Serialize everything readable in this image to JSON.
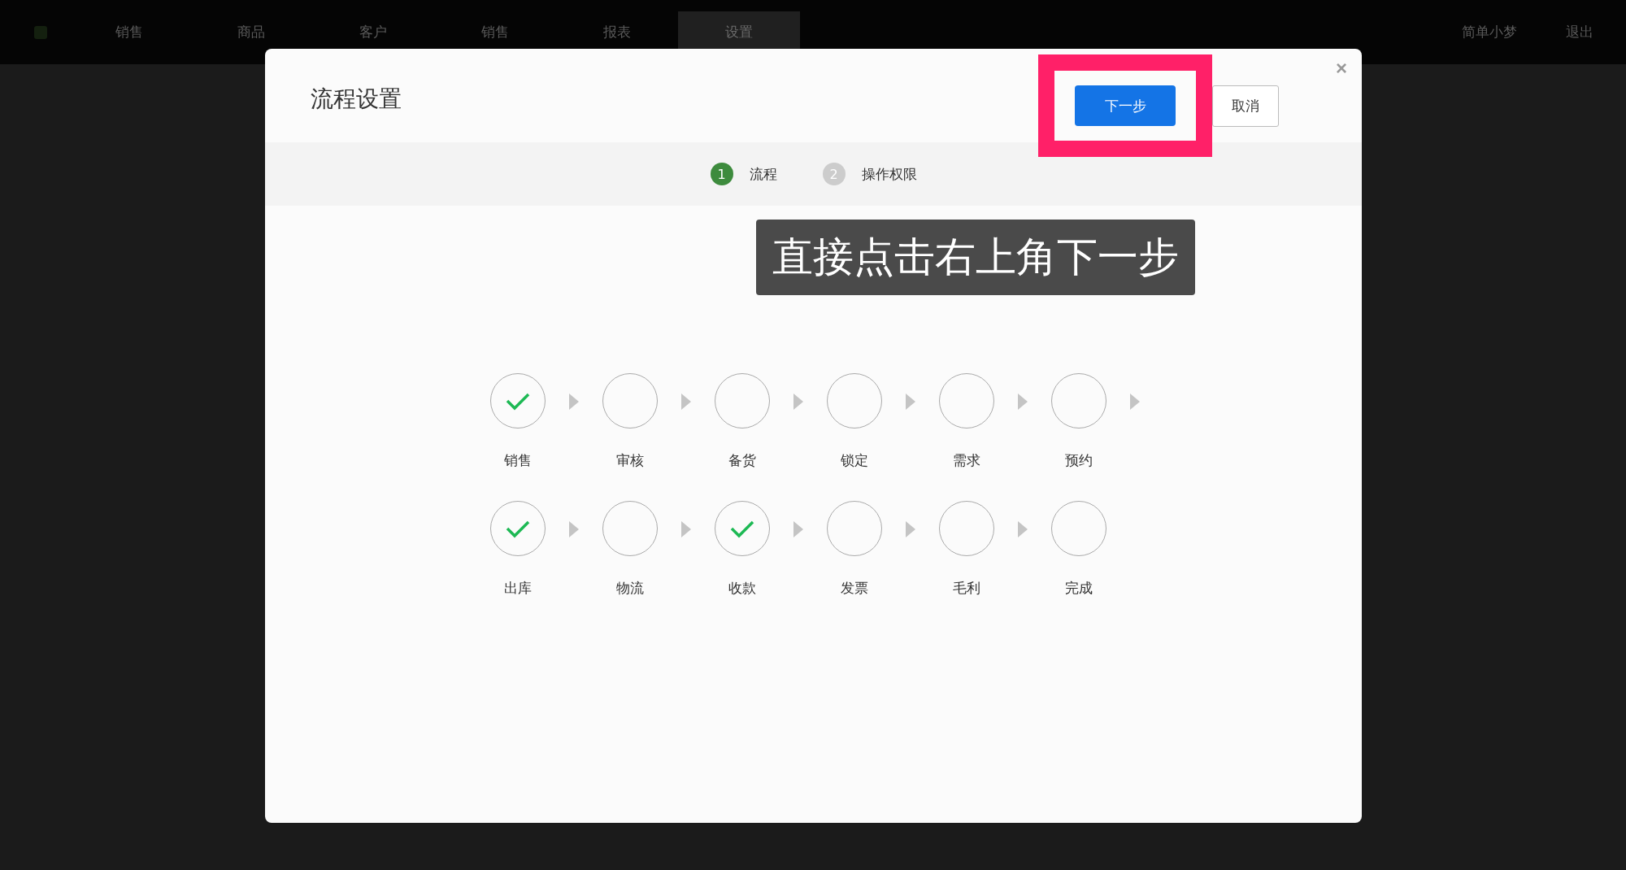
{
  "top_bar": {
    "nav": [
      {
        "label": "销售",
        "selected": false
      },
      {
        "label": "商品",
        "selected": false
      },
      {
        "label": "客户",
        "selected": false
      },
      {
        "label": "销售",
        "selected": false
      },
      {
        "label": "报表",
        "selected": false
      },
      {
        "label": "设置",
        "selected": true
      }
    ],
    "user": "简单小梦",
    "logout": "退出"
  },
  "dialog": {
    "title": "流程设置",
    "next_button": "下一步",
    "cancel_button": "取消",
    "close": "×",
    "steps": [
      {
        "number": "1",
        "label": "流程",
        "selected": true
      },
      {
        "number": "2",
        "label": "操作权限",
        "selected": false
      }
    ],
    "hint": "直接点击右上角下一步",
    "rows": [
      {
        "trailing_arrow": true,
        "nodes": [
          {
            "label": "销售",
            "checked": true
          },
          {
            "label": "审核",
            "checked": false
          },
          {
            "label": "备货",
            "checked": false
          },
          {
            "label": "锁定",
            "checked": false
          },
          {
            "label": "需求",
            "checked": false
          },
          {
            "label": "预约",
            "checked": false
          }
        ]
      },
      {
        "trailing_arrow": false,
        "nodes": [
          {
            "label": "出库",
            "checked": true
          },
          {
            "label": "物流",
            "checked": false
          },
          {
            "label": "收款",
            "checked": true
          },
          {
            "label": "发票",
            "checked": false
          },
          {
            "label": "毛利",
            "checked": false
          },
          {
            "label": "完成",
            "checked": false
          }
        ]
      }
    ]
  }
}
